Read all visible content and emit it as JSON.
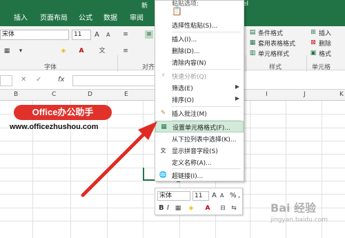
{
  "title_bar": {
    "title_fragment_left": "新",
    "title_fragment_right": "el"
  },
  "tabs": [
    "插入",
    "页面布局",
    "公式",
    "数据",
    "审阅"
  ],
  "ribbon": {
    "font_name": "宋体",
    "font_size": "11",
    "font_grow": "A",
    "font_shrink": "A",
    "font_group_label": "字体",
    "align_group_label": "对齐",
    "styles": {
      "items": [
        "条件格式",
        "套用表格格式",
        "单元格样式"
      ],
      "group_label": "样式"
    },
    "cells": {
      "items": [
        "插入",
        "删除",
        "格式"
      ],
      "group_label": "单元格"
    }
  },
  "formula_bar": {
    "fx": "fx"
  },
  "columns": [
    "B",
    "C",
    "D",
    "E",
    "I",
    "J",
    "K"
  ],
  "context_menu": {
    "paste_options_label": "粘贴选项:",
    "items": [
      {
        "label": "选择性粘贴(S)...",
        "disabled": false,
        "submenu": false,
        "icon": "paste-special-icon"
      },
      {
        "label": "插入(I)...",
        "disabled": false,
        "submenu": false,
        "icon": ""
      },
      {
        "label": "删除(D)...",
        "disabled": false,
        "submenu": false,
        "icon": ""
      },
      {
        "label": "清除内容(N)",
        "disabled": false,
        "submenu": false,
        "icon": ""
      },
      {
        "label": "快速分析(Q)",
        "disabled": true,
        "submenu": false,
        "icon": "quick-analysis-icon"
      },
      {
        "label": "筛选(E)",
        "disabled": false,
        "submenu": true,
        "icon": ""
      },
      {
        "label": "排序(O)",
        "disabled": false,
        "submenu": true,
        "icon": ""
      },
      {
        "label": "插入批注(M)",
        "disabled": false,
        "submenu": false,
        "icon": "comment-icon"
      },
      {
        "label": "设置单元格格式(F)...",
        "disabled": false,
        "submenu": false,
        "icon": "format-cells-icon",
        "highlighted": true
      },
      {
        "label": "从下拉列表中选择(K)...",
        "disabled": false,
        "submenu": false,
        "icon": ""
      },
      {
        "label": "显示拼音字段(S)",
        "disabled": false,
        "submenu": false,
        "icon": "phonetic-icon"
      },
      {
        "label": "定义名称(A)...",
        "disabled": false,
        "submenu": false,
        "icon": ""
      },
      {
        "label": "超链接(I)...",
        "disabled": false,
        "submenu": false,
        "icon": "hyperlink-icon"
      }
    ]
  },
  "mini_toolbar": {
    "font_name": "宋体",
    "font_size": "11",
    "percent": "%",
    "comma": ","
  },
  "overlay": {
    "brand": "Office办公助手",
    "site": "www.officezhushou.com",
    "watermark": "Bai 经验",
    "watermark_url": "jingyan.baidu.com"
  },
  "colors": {
    "excel_green": "#217346",
    "arrow_red": "#e02a24",
    "brand_red": "#e0322b",
    "menu_highlight": "#d3eadb"
  }
}
